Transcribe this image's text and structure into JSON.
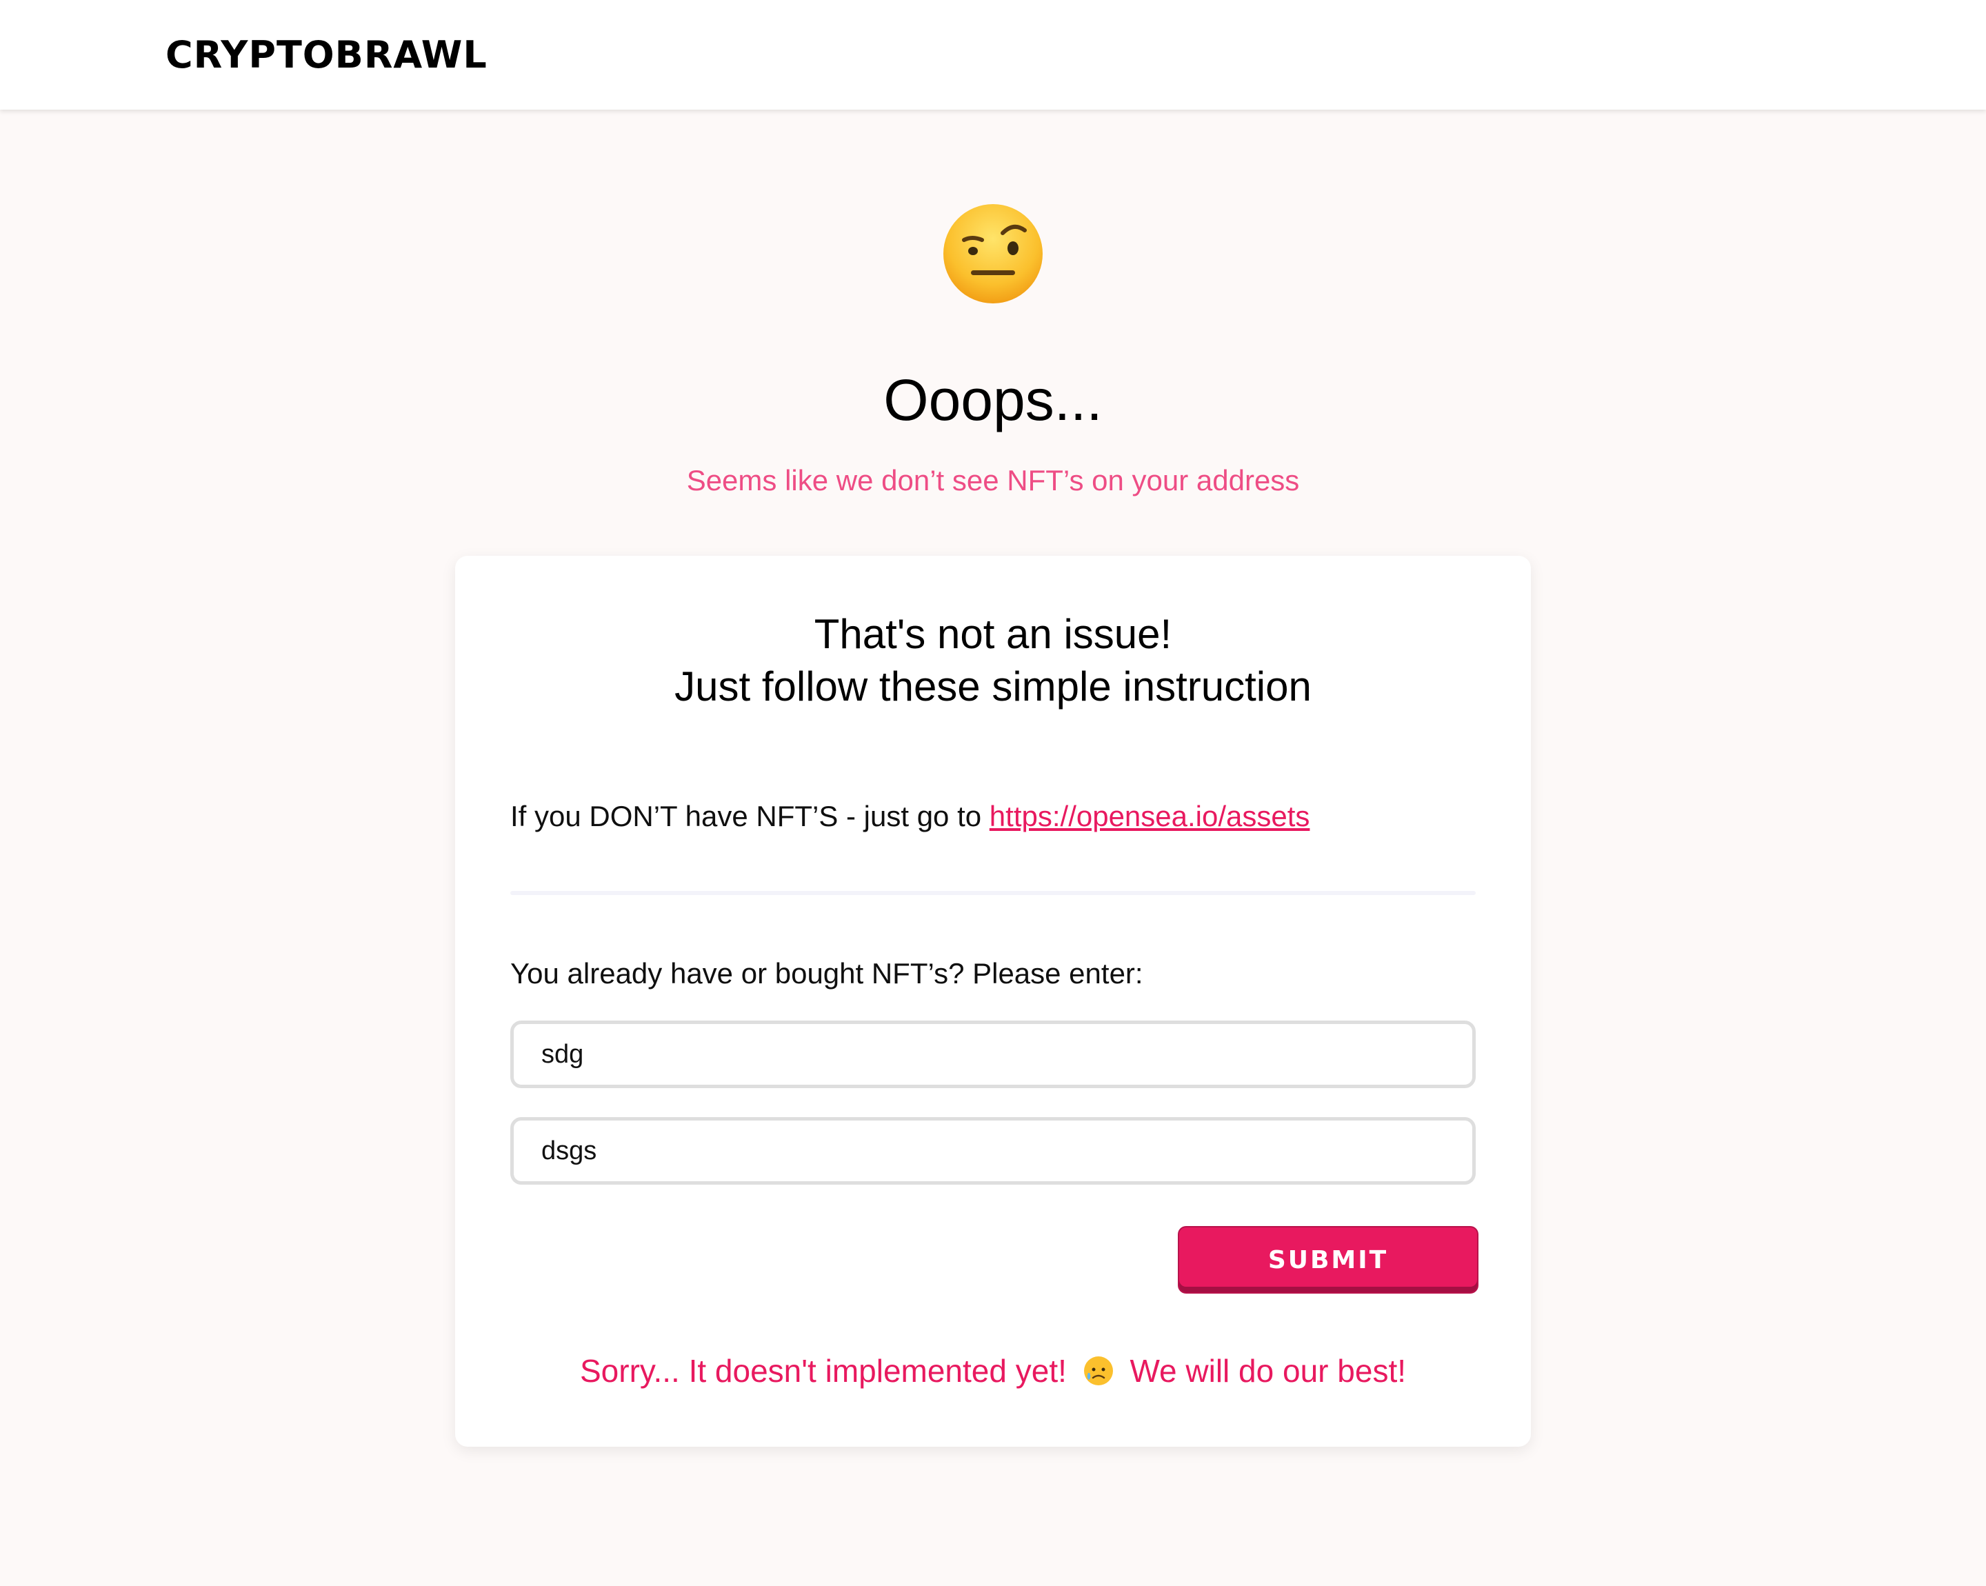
{
  "header": {
    "brand": "CRYPTOBRAWL"
  },
  "hero": {
    "icon": "raised-eyebrow-face-icon",
    "title": "Ooops...",
    "subtitle": "Seems like we don’t see NFT’s on your address"
  },
  "card": {
    "heading_line1": "That's not an issue!",
    "heading_line2": "Just follow these simple instruction",
    "no_nft_text": "If you DON’T have NFT’S - just go to ",
    "opensea_link": "https://opensea.io/assets",
    "have_nft_text": "You already have or bought NFT’s? Please enter:",
    "field1_value": "sdg",
    "field2_value": "dsgs",
    "submit_label": "SUBMIT",
    "sorry_text_before": "Sorry... It doesn't implemented yet!",
    "sorry_icon": "sad-sweat-face-icon",
    "sorry_text_after": "We will do our best!"
  },
  "colors": {
    "accent": "#e8195f",
    "subtitle": "#ee4d85",
    "background": "#fdf9f8"
  }
}
